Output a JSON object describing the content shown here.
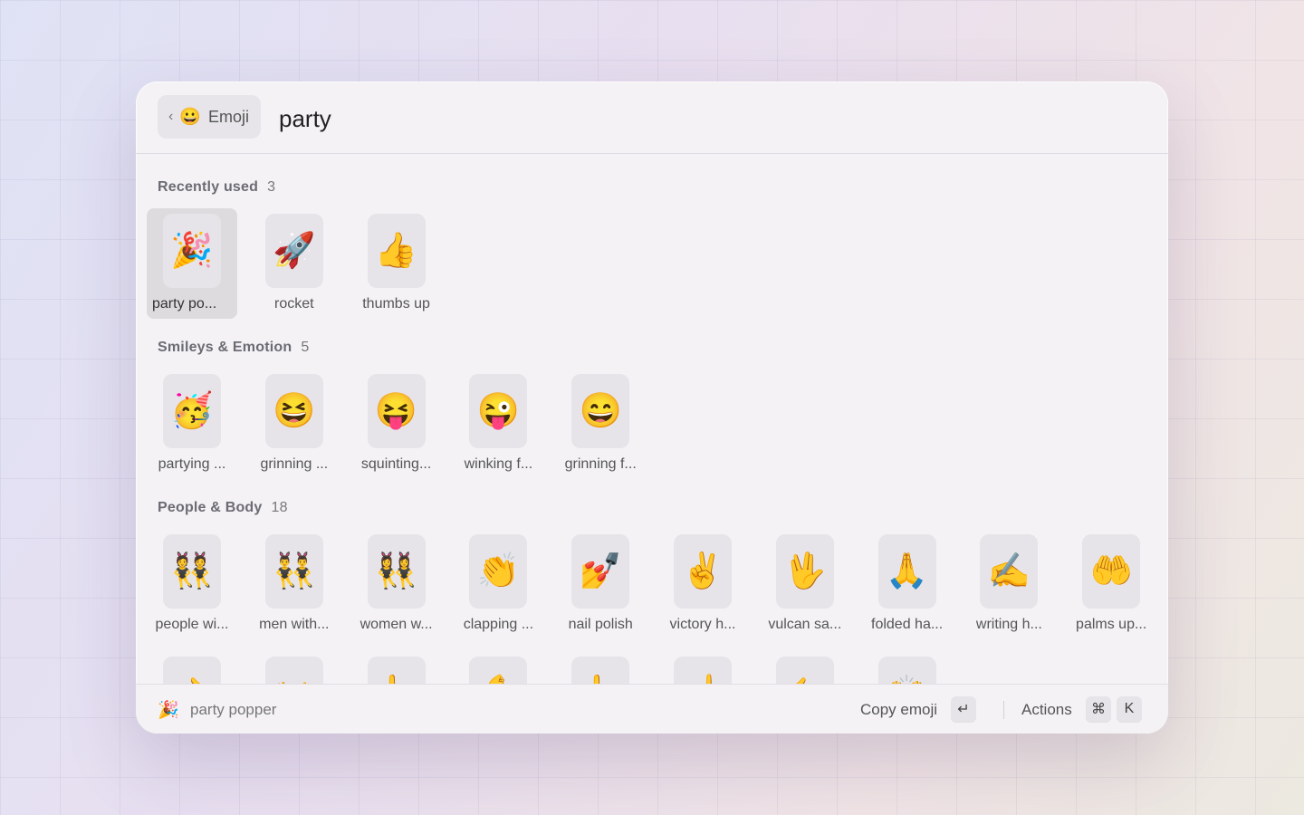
{
  "header": {
    "back_label": "Emoji",
    "back_emoji": "😀",
    "back_chevron": "‹",
    "search_value": "party"
  },
  "sections": [
    {
      "title": "Recently used",
      "count": "3",
      "items": [
        {
          "emoji": "🎉",
          "label": "party po...",
          "selected": true
        },
        {
          "emoji": "🚀",
          "label": "rocket"
        },
        {
          "emoji": "👍",
          "label": "thumbs up"
        }
      ]
    },
    {
      "title": "Smileys & Emotion",
      "count": "5",
      "items": [
        {
          "emoji": "🥳",
          "label": "partying ..."
        },
        {
          "emoji": "😆",
          "label": "grinning ..."
        },
        {
          "emoji": "😝",
          "label": "squinting..."
        },
        {
          "emoji": "😜",
          "label": "winking f..."
        },
        {
          "emoji": "😄",
          "label": "grinning f..."
        }
      ]
    },
    {
      "title": "People & Body",
      "count": "18",
      "items": [
        {
          "emoji": "👯",
          "label": "people wi..."
        },
        {
          "emoji": "👯‍♂️",
          "label": "men with..."
        },
        {
          "emoji": "👯‍♀️",
          "label": "women w..."
        },
        {
          "emoji": "👏",
          "label": "clapping ..."
        },
        {
          "emoji": "💅",
          "label": "nail polish"
        },
        {
          "emoji": "✌️",
          "label": "victory h..."
        },
        {
          "emoji": "🖖",
          "label": "vulcan sa..."
        },
        {
          "emoji": "🙏",
          "label": "folded ha..."
        },
        {
          "emoji": "✍️",
          "label": "writing h..."
        },
        {
          "emoji": "🤲",
          "label": "palms up..."
        }
      ],
      "more_items": [
        {
          "emoji": "🫲"
        },
        {
          "emoji": "👐"
        },
        {
          "emoji": "👆"
        },
        {
          "emoji": "💪"
        },
        {
          "emoji": "👆"
        },
        {
          "emoji": "☝️"
        },
        {
          "emoji": "🫱"
        },
        {
          "emoji": "🙌"
        }
      ]
    }
  ],
  "footer": {
    "selected_emoji": "🎉",
    "selected_name": "party popper",
    "primary_action": "Copy emoji",
    "enter_key": "↵",
    "actions_label": "Actions",
    "cmd_key": "⌘",
    "k_key": "K"
  }
}
